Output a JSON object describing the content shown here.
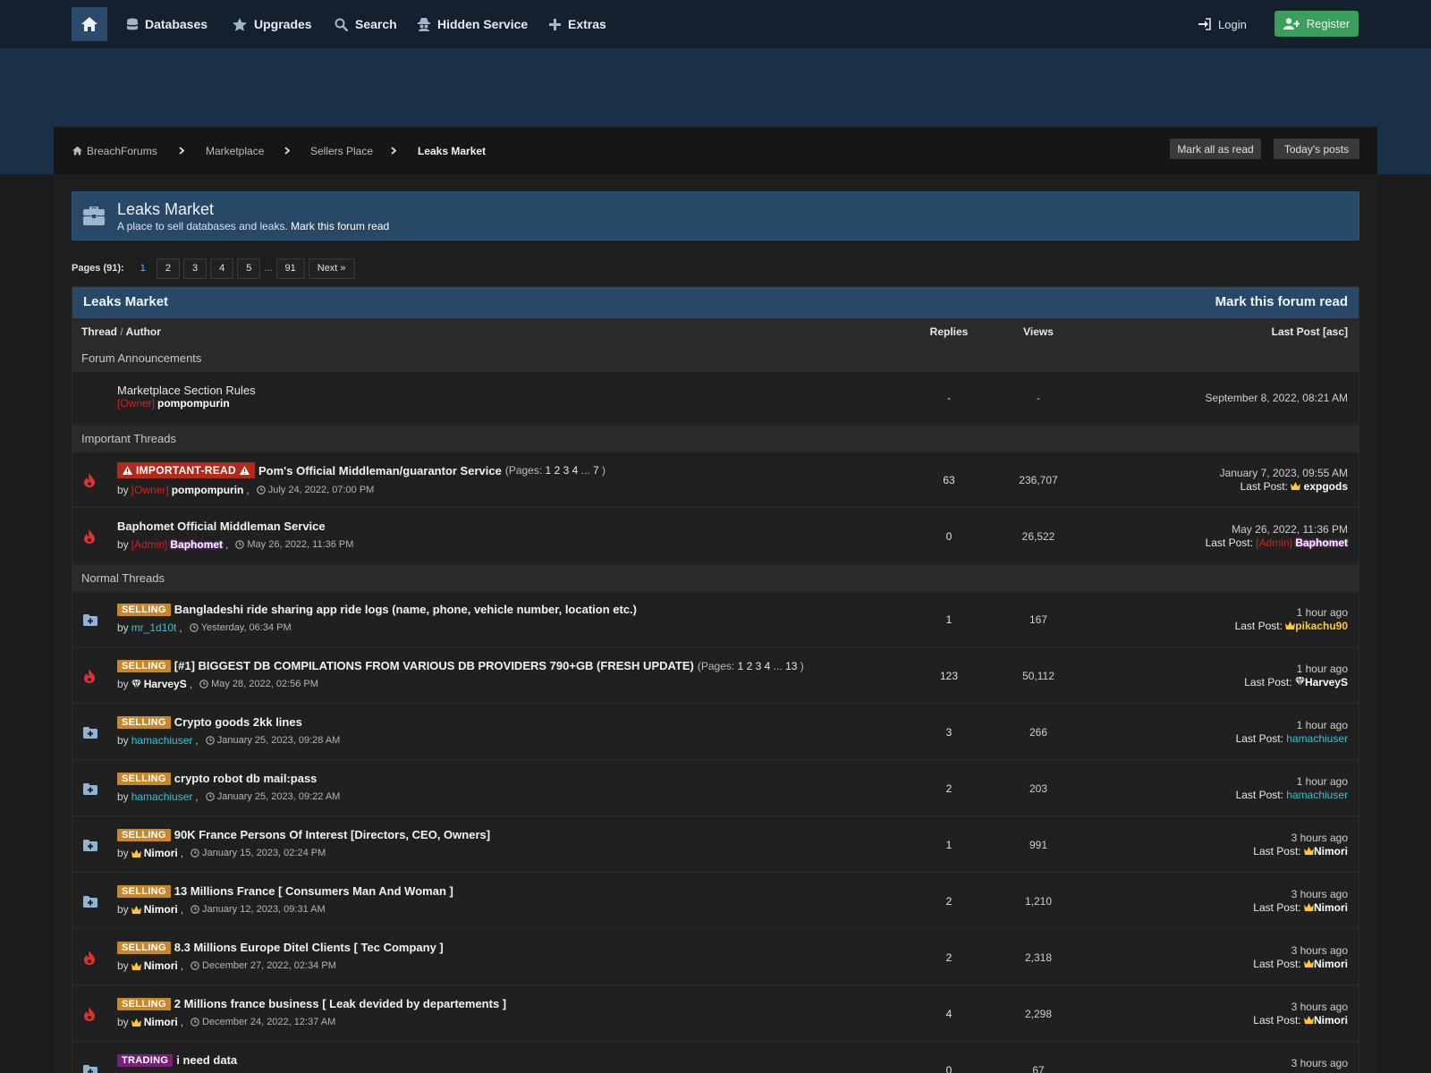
{
  "nav": {
    "items": [
      {
        "label": "Databases",
        "icon": "database-icon"
      },
      {
        "label": "Upgrades",
        "icon": "star-icon"
      },
      {
        "label": "Search",
        "icon": "search-icon"
      },
      {
        "label": "Hidden Service",
        "icon": "spy-icon"
      },
      {
        "label": "Extras",
        "icon": "plus-icon"
      }
    ],
    "login": "Login",
    "register": "Register"
  },
  "breadcrumb": {
    "items": [
      "BreachForums",
      "Marketplace",
      "Sellers Place",
      "Leaks Market"
    ],
    "mark_all_read": "Mark all as read",
    "todays_posts": "Today's posts"
  },
  "forum": {
    "name": "Leaks Market",
    "description": "A place to sell databases and leaks.",
    "mark_read_link": "Mark this forum read"
  },
  "pager": {
    "label": "Pages (91):",
    "current": "1",
    "pages": [
      "2",
      "3",
      "4",
      "5"
    ],
    "dots": "...",
    "last": "91",
    "next": "Next »"
  },
  "table": {
    "title": "Leaks Market",
    "mark_read": "Mark this forum read",
    "col_thread": "Thread",
    "col_sep": "/",
    "col_author": "Author",
    "col_replies": "Replies",
    "col_views": "Views",
    "col_lastpost": "Last Post",
    "col_sort": "[asc]",
    "sections": {
      "announcements": "Forum Announcements",
      "important": "Important Threads",
      "normal": "Normal Threads"
    },
    "announcement": {
      "title": "Marketplace Section Rules",
      "role": "[Owner]",
      "author": "pompompurin",
      "replies": "-",
      "views": "-",
      "last": "September 8, 2022, 08:21 AM"
    },
    "important": [
      {
        "badge": "IMPORTANT-READ",
        "title": "Pom's Official Middleman/guarantor Service",
        "pages_prefix": "(Pages:",
        "pages": [
          "1",
          "2",
          "3",
          "4",
          "...",
          "7"
        ],
        "pages_suffix": ")",
        "by": "by",
        "role": "[Owner]",
        "author": "pompompurin",
        "date": "July 24, 2022, 07:00 PM",
        "replies": "63",
        "views": "236,707",
        "last_date": "January 7, 2023, 09:55 AM",
        "last_label": "Last Post:",
        "last_user": "expgods"
      },
      {
        "title": "Baphomet Official Middleman Service",
        "by": "by",
        "role": "[Admin]",
        "author": "Baphomet",
        "date": "May 26, 2022, 11:36 PM",
        "replies": "0",
        "views": "26,522",
        "last_date": "May 26, 2022, 11:36 PM",
        "last_label": "Last Post:",
        "last_role": "[Admin]",
        "last_user": "Baphomet"
      }
    ],
    "normal": [
      {
        "badge": "SELLING",
        "title": "Bangladeshi ride sharing app ride logs (name, phone, vehicle number, location etc.)",
        "by": "by",
        "author": "mr_1d10t",
        "date": "Yesterday, 06:34 PM",
        "replies": "1",
        "views": "167",
        "last_date": "1 hour ago",
        "last_label": "Last Post:",
        "last_user": "pikachu90"
      },
      {
        "badge": "SELLING",
        "title": "[#1] BIGGEST DB COMPILATIONS FROM VARIOUS DB PROVIDERS 790+GB (FRESH UPDATE)",
        "pages_prefix": "(Pages:",
        "pages": [
          "1",
          "2",
          "3",
          "4",
          "...",
          "13"
        ],
        "pages_suffix": ")",
        "by": "by",
        "author": "HarveyS",
        "date": "May 28, 2022, 02:56 PM",
        "replies": "123",
        "views": "50,112",
        "last_date": "1 hour ago",
        "last_label": "Last Post:",
        "last_user": "HarveyS"
      },
      {
        "badge": "SELLING",
        "title": "Crypto goods 2kk lines",
        "by": "by",
        "author": "hamachiuser",
        "date": "January 25, 2023, 09:28 AM",
        "replies": "3",
        "views": "266",
        "last_date": "1 hour ago",
        "last_label": "Last Post:",
        "last_user": "hamachiuser"
      },
      {
        "badge": "SELLING",
        "title": "crypto robot db mail:pass",
        "by": "by",
        "author": "hamachiuser",
        "date": "January 25, 2023, 09:22 AM",
        "replies": "2",
        "views": "203",
        "last_date": "1 hour ago",
        "last_label": "Last Post:",
        "last_user": "hamachiuser"
      },
      {
        "badge": "SELLING",
        "title": "90K France Persons Of Interest [Directors, CEO, Owners]",
        "by": "by",
        "author": "Nimori",
        "date": "January 15, 2023, 02:24 PM",
        "replies": "1",
        "views": "991",
        "last_date": "3 hours ago",
        "last_label": "Last Post:",
        "last_user": "Nimori"
      },
      {
        "badge": "SELLING",
        "title": "13 Millions France  [ Consumers Man And Woman ]",
        "by": "by",
        "author": "Nimori",
        "date": "January 12, 2023, 09:31 AM",
        "replies": "2",
        "views": "1,210",
        "last_date": "3 hours ago",
        "last_label": "Last Post:",
        "last_user": "Nimori"
      },
      {
        "badge": "SELLING",
        "title": "8.3 Millions Europe Ditel Clients [ Tec Company ]",
        "by": "by",
        "author": "Nimori",
        "date": "December 27, 2022, 02:34 PM",
        "replies": "2",
        "views": "2,318",
        "last_date": "3 hours ago",
        "last_label": "Last Post:",
        "last_user": "Nimori"
      },
      {
        "badge": "SELLING",
        "title": "2 Millions france business [ Leak devided by departements ]",
        "by": "by",
        "author": "Nimori",
        "date": "December 24, 2022, 12:37 AM",
        "replies": "4",
        "views": "2,298",
        "last_date": "3 hours ago",
        "last_label": "Last Post:",
        "last_user": "Nimori"
      },
      {
        "badge": "TRADING",
        "title": "i need data",
        "replies": "0",
        "views": "67",
        "last_date": "3 hours ago"
      }
    ]
  },
  "colors": {
    "accent": "#284868",
    "selling": "#c8882a",
    "trading": "#7a1f7a",
    "important": "#b12a1a",
    "owner": "#d32020",
    "cyan_user": "#35c4cf",
    "gold_user": "#ffc83a",
    "register": "#3a9e5c"
  }
}
